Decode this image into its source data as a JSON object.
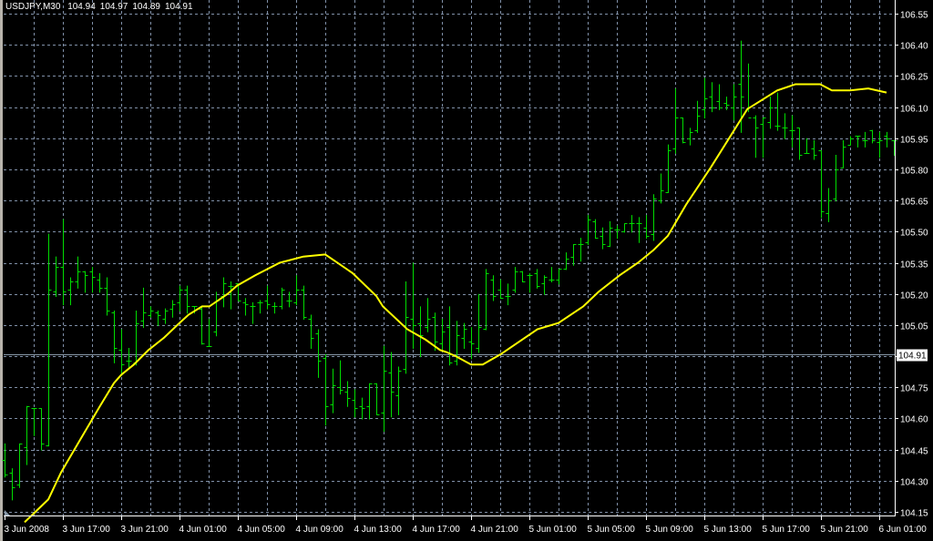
{
  "header": {
    "symbol": "USDJPY,M30",
    "open": "104.94",
    "high": "104.97",
    "low": "104.89",
    "close": "104.91"
  },
  "bid_label": "104.91",
  "colors": {
    "bars": "#00dc00",
    "ma": "#ffff00",
    "grid": "#8090a8",
    "background": "#000000",
    "bid_line": "#8898a8"
  },
  "chart_data": {
    "type": "ohlc",
    "title": "USDJPY,M30",
    "price_ticks": [
      "106.55",
      "106.40",
      "106.25",
      "106.10",
      "105.95",
      "105.80",
      "105.65",
      "105.50",
      "105.35",
      "105.20",
      "105.05",
      "104.90",
      "104.75",
      "104.60",
      "104.45",
      "104.30",
      "104.15"
    ],
    "price_tick_labels": [
      "106.55",
      "106.40",
      "106.25",
      "106.10",
      "105.95",
      "105.80",
      "105.65",
      "105.50",
      "105.35",
      "105.20",
      "104.75",
      "104.60",
      "104.45",
      "104.30",
      "104.15",
      "105.05"
    ],
    "ylim": [
      104.1,
      106.6
    ],
    "bid": 104.91,
    "time_labels": [
      "3 Jun 2008",
      "3 Jun 17:00",
      "3 Jun 21:00",
      "4 Jun 01:00",
      "4 Jun 05:00",
      "4 Jun 09:00",
      "4 Jun 13:00",
      "4 Jun 17:00",
      "4 Jun 21:00",
      "5 Jun 01:00",
      "5 Jun 05:00",
      "5 Jun 09:00",
      "5 Jun 13:00",
      "5 Jun 17:00",
      "5 Jun 21:00",
      "6 Jun 01:00"
    ],
    "bars_per_time_label": 8,
    "ohlc": [
      [
        104.4,
        104.48,
        104.32,
        104.33
      ],
      [
        104.34,
        104.36,
        104.21,
        104.27
      ],
      [
        104.28,
        104.48,
        104.27,
        104.48
      ],
      [
        104.46,
        104.66,
        104.38,
        104.66
      ],
      [
        104.65,
        104.65,
        104.52,
        104.65
      ],
      [
        104.65,
        104.65,
        104.45,
        104.48
      ],
      [
        104.47,
        105.49,
        104.47,
        105.22
      ],
      [
        105.21,
        105.38,
        105.19,
        105.33
      ],
      [
        105.33,
        105.56,
        105.15,
        105.21
      ],
      [
        105.22,
        105.28,
        105.15,
        105.26
      ],
      [
        105.26,
        105.38,
        105.23,
        105.31
      ],
      [
        105.31,
        105.31,
        105.21,
        105.29
      ],
      [
        105.31,
        105.33,
        105.21,
        105.28
      ],
      [
        105.27,
        105.3,
        105.21,
        105.23
      ],
      [
        105.23,
        105.28,
        105.1,
        105.12
      ],
      [
        105.11,
        105.12,
        104.87,
        104.94
      ],
      [
        104.93,
        105.03,
        104.81,
        104.86
      ],
      [
        104.88,
        104.94,
        104.84,
        104.88
      ],
      [
        104.87,
        105.12,
        104.86,
        105.06
      ],
      [
        105.07,
        105.23,
        105.04,
        105.11
      ],
      [
        105.1,
        105.14,
        105.09,
        105.12
      ],
      [
        105.11,
        105.12,
        105.05,
        105.1
      ],
      [
        105.08,
        105.13,
        105.06,
        105.12
      ],
      [
        105.13,
        105.17,
        105.09,
        105.15
      ],
      [
        105.16,
        105.24,
        105.12,
        105.22
      ],
      [
        105.22,
        105.24,
        105.11,
        105.14
      ],
      [
        105.14,
        105.14,
        105.11,
        105.14
      ],
      [
        105.13,
        105.14,
        104.96,
        104.96
      ],
      [
        104.95,
        105.08,
        104.95,
        104.95
      ],
      [
        105.02,
        105.21,
        105.0,
        105.17
      ],
      [
        105.19,
        105.28,
        105.14,
        105.25
      ],
      [
        105.24,
        105.26,
        105.13,
        105.24
      ],
      [
        105.25,
        105.25,
        105.17,
        105.17
      ],
      [
        105.16,
        105.18,
        105.1,
        105.15
      ],
      [
        105.14,
        105.16,
        105.06,
        105.14
      ],
      [
        105.16,
        105.17,
        105.11,
        105.16
      ],
      [
        105.17,
        105.24,
        105.13,
        105.15
      ],
      [
        105.14,
        105.16,
        105.11,
        105.14
      ],
      [
        105.14,
        105.23,
        105.13,
        105.22
      ],
      [
        105.17,
        105.21,
        105.14,
        105.17
      ],
      [
        105.16,
        105.29,
        105.15,
        105.22
      ],
      [
        105.22,
        105.24,
        105.08,
        105.09
      ],
      [
        105.08,
        105.1,
        104.94,
        104.99
      ],
      [
        105.01,
        105.03,
        104.8,
        104.88
      ],
      [
        104.89,
        104.91,
        104.57,
        104.66
      ],
      [
        104.67,
        104.84,
        104.63,
        104.76
      ],
      [
        104.75,
        104.88,
        104.72,
        104.74
      ],
      [
        104.73,
        104.78,
        104.66,
        104.7
      ],
      [
        104.69,
        104.74,
        104.61,
        104.65
      ],
      [
        104.66,
        104.7,
        104.6,
        104.65
      ],
      [
        104.66,
        104.77,
        104.6,
        104.77
      ],
      [
        104.77,
        104.77,
        104.62,
        104.62
      ],
      [
        104.63,
        104.95,
        104.54,
        104.83
      ],
      [
        104.82,
        104.92,
        104.61,
        104.73
      ],
      [
        104.71,
        104.85,
        104.62,
        104.83
      ],
      [
        104.84,
        105.26,
        104.82,
        105.09
      ],
      [
        105.08,
        105.35,
        104.94,
        105.05
      ],
      [
        105.06,
        105.14,
        104.9,
        105.0
      ],
      [
        105.04,
        105.18,
        105.02,
        105.08
      ],
      [
        105.09,
        105.11,
        104.93,
        104.97
      ],
      [
        104.96,
        105.08,
        104.93,
        105.02
      ],
      [
        105.04,
        105.14,
        104.86,
        104.87
      ],
      [
        104.88,
        105.07,
        104.86,
        105.0
      ],
      [
        104.99,
        105.06,
        104.94,
        105.03
      ],
      [
        104.97,
        105.04,
        104.89,
        104.96
      ],
      [
        104.94,
        105.2,
        104.92,
        105.04
      ],
      [
        105.03,
        105.32,
        105.03,
        105.3
      ],
      [
        105.27,
        105.29,
        105.17,
        105.19
      ],
      [
        105.22,
        105.27,
        105.18,
        105.18
      ],
      [
        105.19,
        105.25,
        105.15,
        105.19
      ],
      [
        105.22,
        105.33,
        105.21,
        105.31
      ],
      [
        105.31,
        105.31,
        105.26,
        105.26
      ],
      [
        105.29,
        105.3,
        105.21,
        105.29
      ],
      [
        105.3,
        105.32,
        105.23,
        105.24
      ],
      [
        105.25,
        105.29,
        105.2,
        105.28
      ],
      [
        105.27,
        105.33,
        105.26,
        105.27
      ],
      [
        105.27,
        105.32,
        105.25,
        105.32
      ],
      [
        105.32,
        105.4,
        105.32,
        105.37
      ],
      [
        105.38,
        105.44,
        105.34,
        105.44
      ],
      [
        105.44,
        105.47,
        105.36,
        105.44
      ],
      [
        105.45,
        105.58,
        105.44,
        105.56
      ],
      [
        105.55,
        105.56,
        105.47,
        105.47
      ],
      [
        105.48,
        105.52,
        105.42,
        105.44
      ],
      [
        105.43,
        105.55,
        105.43,
        105.52
      ],
      [
        105.51,
        105.53,
        105.47,
        105.51
      ],
      [
        105.5,
        105.54,
        105.5,
        105.54
      ],
      [
        105.54,
        105.58,
        105.5,
        105.54
      ],
      [
        105.54,
        105.57,
        105.45,
        105.54
      ],
      [
        105.52,
        105.58,
        105.47,
        105.48
      ],
      [
        105.49,
        105.68,
        105.46,
        105.66
      ],
      [
        105.65,
        105.78,
        105.64,
        105.7
      ],
      [
        105.69,
        105.92,
        105.69,
        105.89
      ],
      [
        105.9,
        106.19,
        105.88,
        106.05
      ],
      [
        106.05,
        106.05,
        105.93,
        105.93
      ],
      [
        105.95,
        106.0,
        105.92,
        105.98
      ],
      [
        105.99,
        106.13,
        105.98,
        106.06
      ],
      [
        106.09,
        106.24,
        106.05,
        106.14
      ],
      [
        106.15,
        106.22,
        106.08,
        106.1
      ],
      [
        106.13,
        106.21,
        106.09,
        106.1
      ],
      [
        106.12,
        106.15,
        106.09,
        106.11
      ],
      [
        106.1,
        106.21,
        106.04,
        106.15
      ],
      [
        106.21,
        106.42,
        105.98,
        106.15
      ],
      [
        106.09,
        106.31,
        106.08,
        106.05
      ],
      [
        106.05,
        106.06,
        105.86,
        106.0
      ],
      [
        106.02,
        106.05,
        105.86,
        106.05
      ],
      [
        106.03,
        106.15,
        106.0,
        106.1
      ],
      [
        106.01,
        106.17,
        105.99,
        106.01
      ],
      [
        106.0,
        106.07,
        105.95,
        106.0
      ],
      [
        105.99,
        106.06,
        105.91,
        105.99
      ],
      [
        106.0,
        106.0,
        105.85,
        105.87
      ],
      [
        105.88,
        105.95,
        105.88,
        105.88
      ],
      [
        105.9,
        105.94,
        105.85,
        105.87
      ],
      [
        105.89,
        105.89,
        105.57,
        105.6
      ],
      [
        105.59,
        105.71,
        105.55,
        105.65
      ],
      [
        105.66,
        105.87,
        105.65,
        105.8
      ],
      [
        105.81,
        105.94,
        105.81,
        105.91
      ],
      [
        105.92,
        105.96,
        105.92,
        105.95
      ],
      [
        105.96,
        105.96,
        105.91,
        105.96
      ],
      [
        105.94,
        105.98,
        105.91,
        105.94
      ],
      [
        105.99,
        105.99,
        105.93,
        105.94
      ],
      [
        105.93,
        105.98,
        105.86,
        105.94
      ],
      [
        105.96,
        105.98,
        105.91,
        105.95
      ],
      [
        105.94,
        105.94,
        105.87,
        105.94
      ]
    ],
    "ma": [
      [
        2.75,
        104.1
      ],
      [
        6,
        104.21
      ],
      [
        7.75,
        104.34
      ],
      [
        10.25,
        104.49
      ],
      [
        13.1,
        104.66
      ],
      [
        15,
        104.77
      ],
      [
        16,
        104.81
      ],
      [
        17.75,
        104.86
      ],
      [
        19.75,
        104.93
      ],
      [
        21.9,
        104.99
      ],
      [
        24,
        105.06
      ],
      [
        25.25,
        105.1
      ],
      [
        27.1,
        105.14
      ],
      [
        28.1,
        105.14
      ],
      [
        30.6,
        105.2
      ],
      [
        31.9,
        105.24
      ],
      [
        34.4,
        105.29
      ],
      [
        37.75,
        105.35
      ],
      [
        41,
        105.38
      ],
      [
        44,
        105.39
      ],
      [
        45.25,
        105.36
      ],
      [
        47.75,
        105.3
      ],
      [
        51,
        105.19
      ],
      [
        51.9,
        105.14
      ],
      [
        55.25,
        105.03
      ],
      [
        57.75,
        104.98
      ],
      [
        59.75,
        104.93
      ],
      [
        60.6,
        104.92
      ],
      [
        61.9,
        104.9
      ],
      [
        64,
        104.86
      ],
      [
        65.6,
        104.86
      ],
      [
        68.1,
        104.91
      ],
      [
        73.1,
        105.03
      ],
      [
        76,
        105.06
      ],
      [
        79.4,
        105.14
      ],
      [
        81.5,
        105.21
      ],
      [
        84.4,
        105.29
      ],
      [
        86.9,
        105.35
      ],
      [
        89,
        105.41
      ],
      [
        91,
        105.48
      ],
      [
        93.5,
        105.63
      ],
      [
        96.9,
        105.81
      ],
      [
        99.4,
        105.95
      ],
      [
        101.9,
        106.09
      ],
      [
        106,
        106.18
      ],
      [
        108.5,
        106.21
      ],
      [
        111.9,
        106.21
      ],
      [
        113.5,
        106.18
      ],
      [
        116,
        106.18
      ],
      [
        118.5,
        106.19
      ],
      [
        121,
        106.17
      ]
    ]
  }
}
